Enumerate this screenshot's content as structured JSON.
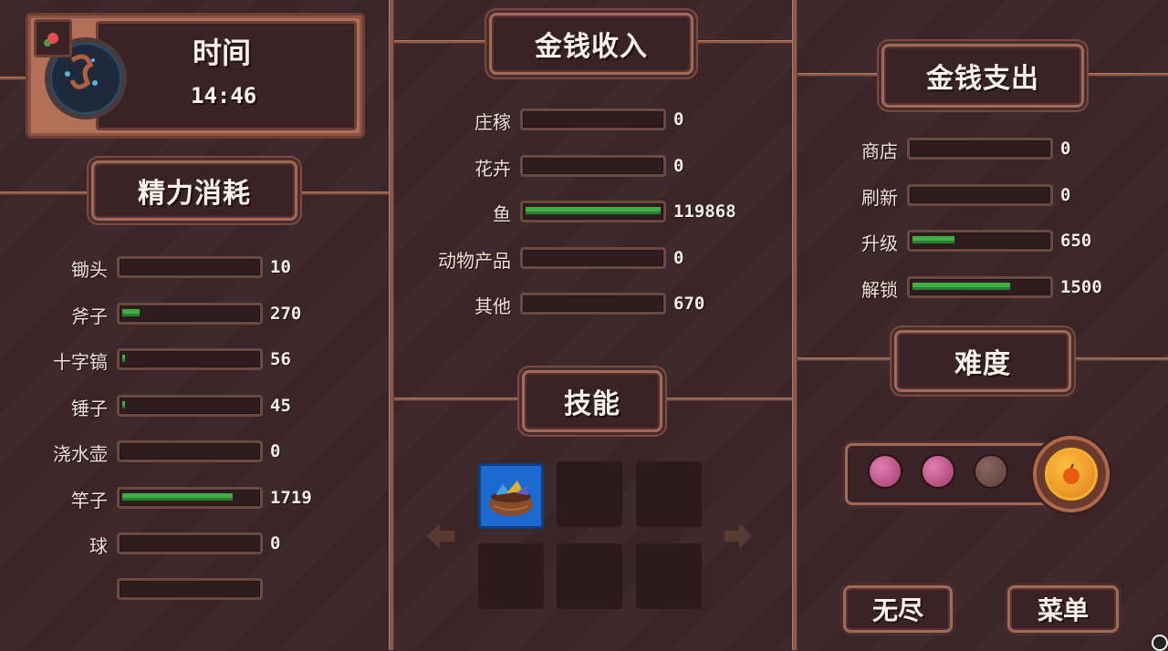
{
  "time": {
    "title": "时间",
    "value": "14:46"
  },
  "energy": {
    "title": "精力消耗",
    "rows": [
      {
        "label": "锄头",
        "value": "10",
        "fill": 0.0
      },
      {
        "label": "斧子",
        "value": "270",
        "fill": 0.13
      },
      {
        "label": "十字镐",
        "value": "56",
        "fill": 0.02
      },
      {
        "label": "锤子",
        "value": "45",
        "fill": 0.02
      },
      {
        "label": "浇水壶",
        "value": "0",
        "fill": 0.0
      },
      {
        "label": "竿子",
        "value": "1719",
        "fill": 0.82
      },
      {
        "label": "球",
        "value": "0",
        "fill": 0.0
      }
    ]
  },
  "income": {
    "title": "金钱收入",
    "rows": [
      {
        "label": "庄稼",
        "value": "0",
        "fill": 0.0
      },
      {
        "label": "花卉",
        "value": "0",
        "fill": 0.0
      },
      {
        "label": "鱼",
        "value": "119868",
        "fill": 1.0
      },
      {
        "label": "动物产品",
        "value": "0",
        "fill": 0.0
      },
      {
        "label": "其他",
        "value": "670",
        "fill": 0.0
      }
    ]
  },
  "skills": {
    "title": "技能"
  },
  "expense": {
    "title": "金钱支出",
    "rows": [
      {
        "label": "商店",
        "value": "0",
        "fill": 0.0
      },
      {
        "label": "刷新",
        "value": "0",
        "fill": 0.0
      },
      {
        "label": "升级",
        "value": "650",
        "fill": 0.31
      },
      {
        "label": "解锁",
        "value": "1500",
        "fill": 0.72
      }
    ]
  },
  "difficulty": {
    "title": "难度"
  },
  "buttons": {
    "endless": "无尽",
    "menu": "菜单"
  },
  "colors": {
    "bar_fill": "#3fae45",
    "orb_active": "#c0558f",
    "orb_inactive": "#6a4a44",
    "coin": "#e8901a"
  }
}
